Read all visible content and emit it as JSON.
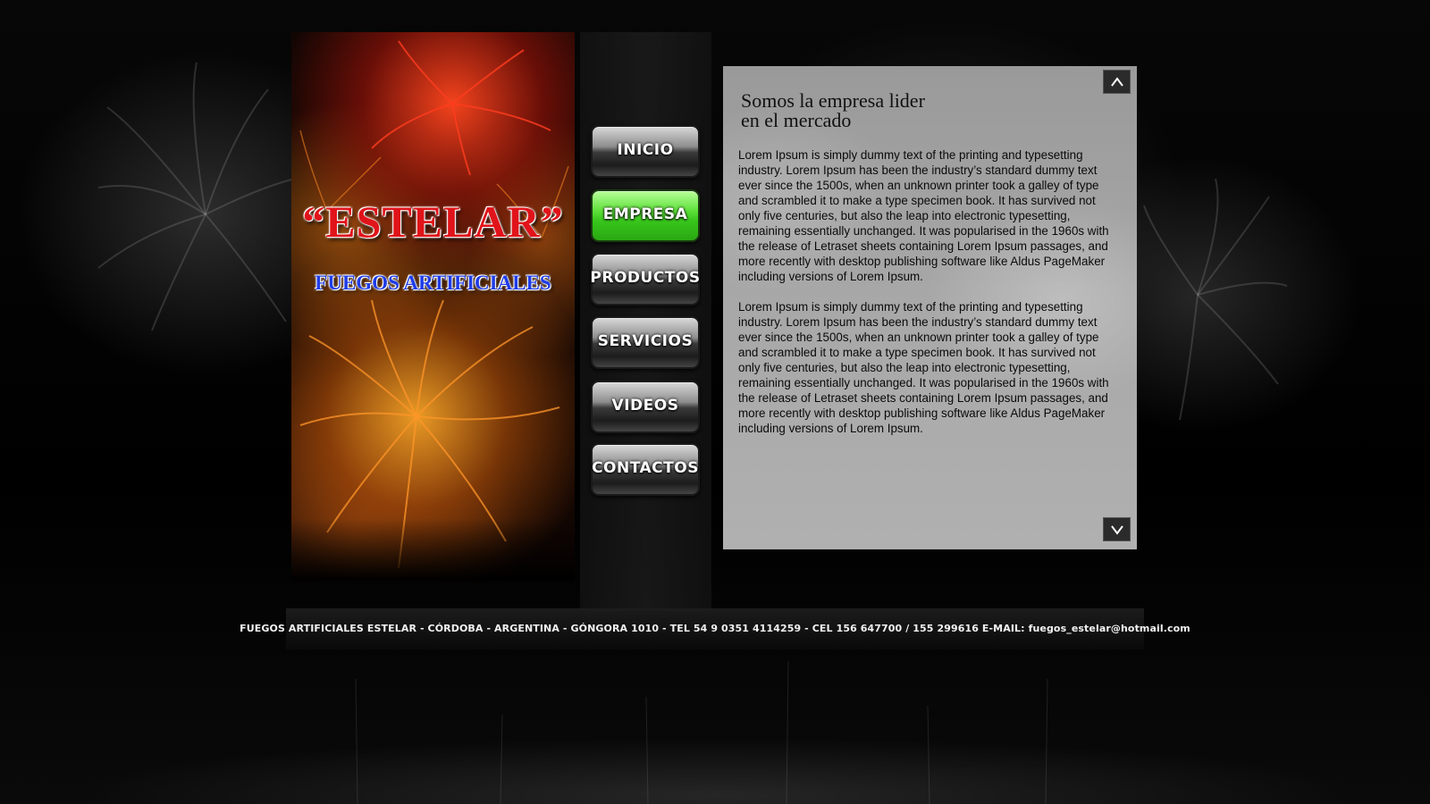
{
  "brand": {
    "title": "“ESTELAR”",
    "subtitle": "FUEGOS ARTIFICIALES"
  },
  "nav": {
    "items": [
      {
        "label": "INICIO",
        "active": false
      },
      {
        "label": "EMPRESA",
        "active": true
      },
      {
        "label": "PRODUCTOS",
        "active": false
      },
      {
        "label": "SERVICIOS",
        "active": false
      },
      {
        "label": "VIDEOS",
        "active": false
      },
      {
        "label": "CONTACTOS",
        "active": false
      }
    ]
  },
  "content": {
    "title_line1": "Somos la empresa lider",
    "title_line2": "en el mercado",
    "paragraphs": [
      "Lorem Ipsum is simply dummy text of the printing and typesetting industry. Lorem Ipsum has been the industry’s standard dummy text ever since the 1500s, when an unknown printer took a galley of type and scrambled it to make a type specimen book. It has survived not only five centuries, but also the leap into electronic typesetting, remaining essentially unchanged. It was popularised in the 1960s with the release of Letraset sheets containing Lorem Ipsum passages, and more recently with desktop publishing software like Aldus PageMaker including versions of Lorem Ipsum.",
      "Lorem Ipsum is simply dummy text of the printing and typesetting industry. Lorem Ipsum has been the industry’s standard dummy text ever since the 1500s, when an unknown printer took a galley of type and scrambled it to make a type specimen book. It has survived not only five centuries, but also the leap into electronic typesetting, remaining essentially unchanged. It was popularised in the 1960s with the release of Letraset sheets containing Lorem Ipsum passages, and more recently with desktop publishing software like Aldus PageMaker including versions of Lorem Ipsum."
    ],
    "scroll_up_icon": "chevron-up-icon",
    "scroll_down_icon": "chevron-down-icon"
  },
  "footer": {
    "text": "FUEGOS ARTIFICIALES ESTELAR - CÓRDOBA - ARGENTINA - GÓNGORA  1010 - TEL 54 9 0351 4114259 - CEL  156 647700 / 155 299616 E-MAIL: fuegos_estelar@hotmail.com"
  },
  "colors": {
    "background": "#000000",
    "brand_red": "#e0141a",
    "brand_blue": "#1f3ce8",
    "nav_active_green": "#38c61c",
    "content_panel": "#a8a8a8"
  }
}
